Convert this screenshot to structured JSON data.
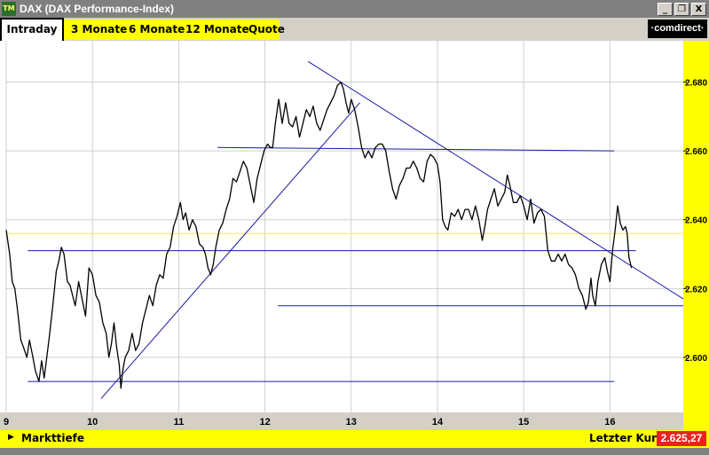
{
  "window": {
    "title": "DAX (DAX Performance-Index)",
    "app_icon_text": "TM",
    "buttons": {
      "minimize": "_",
      "restore": "❐",
      "close": "X"
    }
  },
  "tabs": [
    {
      "label": "Intraday",
      "active": true
    },
    {
      "label": "3 Monate",
      "active": false
    },
    {
      "label": "6 Monate",
      "active": false
    },
    {
      "label": "12 Monate",
      "active": false
    },
    {
      "label": "Quote",
      "active": false
    }
  ],
  "logo": "·comdirect·",
  "bottom": {
    "left_label": "Markttiefe",
    "right_label": "Letzter Kurs",
    "last_price": "2.625,27"
  },
  "colors": {
    "price_line": "#000000",
    "trend_lines": "#1a1aa0",
    "reference_line": "#ffff00",
    "axis_background": "#ffff00",
    "last_price_background": "#e8231f"
  },
  "chart_data": {
    "type": "line",
    "title": "",
    "xlabel": "",
    "ylabel": "",
    "x_ticks": [
      "9",
      "10",
      "11",
      "12",
      "13",
      "14",
      "15",
      "16"
    ],
    "y_ticks": [
      "2.680",
      "2.660",
      "2.640",
      "2.620",
      "2.600"
    ],
    "xlim": [
      9,
      16.85
    ],
    "ylim": [
      2584,
      2692
    ],
    "grid": true,
    "reference_level": 2636,
    "series": [
      {
        "values": [
          [
            9.0,
            2637
          ],
          [
            9.04,
            2630
          ],
          [
            9.07,
            2622
          ],
          [
            9.1,
            2620
          ],
          [
            9.13,
            2614
          ],
          [
            9.17,
            2605
          ],
          [
            9.2,
            2603
          ],
          [
            9.24,
            2600
          ],
          [
            9.27,
            2605
          ],
          [
            9.31,
            2600
          ],
          [
            9.34,
            2596
          ],
          [
            9.38,
            2593
          ],
          [
            9.41,
            2599
          ],
          [
            9.44,
            2594
          ],
          [
            9.47,
            2600
          ],
          [
            9.5,
            2606
          ],
          [
            9.54,
            2615
          ],
          [
            9.58,
            2625
          ],
          [
            9.61,
            2628
          ],
          [
            9.64,
            2632
          ],
          [
            9.67,
            2630
          ],
          [
            9.71,
            2622
          ],
          [
            9.74,
            2621
          ],
          [
            9.77,
            2618
          ],
          [
            9.8,
            2615
          ],
          [
            9.84,
            2622
          ],
          [
            9.88,
            2617
          ],
          [
            9.92,
            2612
          ],
          [
            9.96,
            2626
          ],
          [
            10.0,
            2624
          ],
          [
            10.04,
            2618
          ],
          [
            10.08,
            2616
          ],
          [
            10.12,
            2610
          ],
          [
            10.16,
            2607
          ],
          [
            10.19,
            2600
          ],
          [
            10.22,
            2604
          ],
          [
            10.25,
            2610
          ],
          [
            10.28,
            2603
          ],
          [
            10.31,
            2598
          ],
          [
            10.33,
            2591
          ],
          [
            10.35,
            2596
          ],
          [
            10.38,
            2600
          ],
          [
            10.42,
            2602
          ],
          [
            10.46,
            2607
          ],
          [
            10.5,
            2602
          ],
          [
            10.54,
            2604
          ],
          [
            10.58,
            2610
          ],
          [
            10.62,
            2614
          ],
          [
            10.66,
            2618
          ],
          [
            10.7,
            2615
          ],
          [
            10.74,
            2621
          ],
          [
            10.78,
            2624
          ],
          [
            10.82,
            2623
          ],
          [
            10.86,
            2630
          ],
          [
            10.9,
            2632
          ],
          [
            10.94,
            2638
          ],
          [
            10.98,
            2641
          ],
          [
            11.02,
            2645
          ],
          [
            11.05,
            2640
          ],
          [
            11.08,
            2642
          ],
          [
            11.12,
            2637
          ],
          [
            11.16,
            2640
          ],
          [
            11.2,
            2638
          ],
          [
            11.24,
            2633
          ],
          [
            11.28,
            2632
          ],
          [
            11.31,
            2630
          ],
          [
            11.34,
            2626
          ],
          [
            11.37,
            2624
          ],
          [
            11.4,
            2627
          ],
          [
            11.43,
            2632
          ],
          [
            11.47,
            2637
          ],
          [
            11.51,
            2639
          ],
          [
            11.55,
            2643
          ],
          [
            11.59,
            2646
          ],
          [
            11.63,
            2652
          ],
          [
            11.67,
            2651
          ],
          [
            11.71,
            2654
          ],
          [
            11.75,
            2657
          ],
          [
            11.79,
            2655
          ],
          [
            11.83,
            2650
          ],
          [
            11.87,
            2645
          ],
          [
            11.91,
            2652
          ],
          [
            11.95,
            2656
          ],
          [
            11.99,
            2660
          ],
          [
            12.03,
            2662
          ],
          [
            12.06,
            2661
          ],
          [
            12.09,
            2661
          ],
          [
            12.12,
            2668
          ],
          [
            12.16,
            2675
          ],
          [
            12.2,
            2668
          ],
          [
            12.24,
            2674
          ],
          [
            12.28,
            2668
          ],
          [
            12.32,
            2667
          ],
          [
            12.36,
            2670
          ],
          [
            12.4,
            2664
          ],
          [
            12.44,
            2668
          ],
          [
            12.48,
            2672
          ],
          [
            12.52,
            2670
          ],
          [
            12.56,
            2673
          ],
          [
            12.6,
            2668
          ],
          [
            12.64,
            2666
          ],
          [
            12.68,
            2669
          ],
          [
            12.72,
            2672
          ],
          [
            12.76,
            2674
          ],
          [
            12.8,
            2676
          ],
          [
            12.84,
            2679
          ],
          [
            12.88,
            2680
          ],
          [
            12.91,
            2678
          ],
          [
            12.94,
            2674
          ],
          [
            12.97,
            2671
          ],
          [
            13.0,
            2675
          ],
          [
            13.04,
            2672
          ],
          [
            13.08,
            2667
          ],
          [
            13.12,
            2661
          ],
          [
            13.16,
            2658
          ],
          [
            13.2,
            2660
          ],
          [
            13.24,
            2658
          ],
          [
            13.28,
            2661
          ],
          [
            13.32,
            2662
          ],
          [
            13.36,
            2662
          ],
          [
            13.4,
            2660
          ],
          [
            13.44,
            2654
          ],
          [
            13.48,
            2649
          ],
          [
            13.52,
            2646
          ],
          [
            13.56,
            2650
          ],
          [
            13.6,
            2652
          ],
          [
            13.64,
            2655
          ],
          [
            13.68,
            2655
          ],
          [
            13.72,
            2657
          ],
          [
            13.76,
            2655
          ],
          [
            13.8,
            2652
          ],
          [
            13.84,
            2651
          ],
          [
            13.88,
            2657
          ],
          [
            13.92,
            2659
          ],
          [
            13.96,
            2658
          ],
          [
            14.0,
            2656
          ],
          [
            14.03,
            2651
          ],
          [
            14.06,
            2640
          ],
          [
            14.09,
            2638
          ],
          [
            14.12,
            2637
          ],
          [
            14.16,
            2642
          ],
          [
            14.2,
            2641
          ],
          [
            14.24,
            2643
          ],
          [
            14.28,
            2640
          ],
          [
            14.32,
            2643
          ],
          [
            14.36,
            2643
          ],
          [
            14.4,
            2640
          ],
          [
            14.44,
            2644
          ],
          [
            14.48,
            2640
          ],
          [
            14.52,
            2634
          ],
          [
            14.55,
            2638
          ],
          [
            14.58,
            2643
          ],
          [
            14.62,
            2646
          ],
          [
            14.66,
            2649
          ],
          [
            14.7,
            2644
          ],
          [
            14.74,
            2646
          ],
          [
            14.78,
            2648
          ],
          [
            14.81,
            2653
          ],
          [
            14.84,
            2650
          ],
          [
            14.88,
            2645
          ],
          [
            14.92,
            2645
          ],
          [
            14.96,
            2647
          ],
          [
            15.0,
            2644
          ],
          [
            15.04,
            2640
          ],
          [
            15.08,
            2646
          ],
          [
            15.12,
            2639
          ],
          [
            15.16,
            2642
          ],
          [
            15.2,
            2643
          ],
          [
            15.24,
            2641
          ],
          [
            15.28,
            2631
          ],
          [
            15.32,
            2628
          ],
          [
            15.36,
            2628
          ],
          [
            15.4,
            2630
          ],
          [
            15.44,
            2628
          ],
          [
            15.48,
            2630
          ],
          [
            15.52,
            2627
          ],
          [
            15.56,
            2626
          ],
          [
            15.6,
            2624
          ],
          [
            15.64,
            2620
          ],
          [
            15.68,
            2618
          ],
          [
            15.72,
            2614
          ],
          [
            15.75,
            2616
          ],
          [
            15.78,
            2623
          ],
          [
            15.8,
            2618
          ],
          [
            15.83,
            2615
          ],
          [
            15.86,
            2622
          ],
          [
            15.9,
            2627
          ],
          [
            15.94,
            2629
          ],
          [
            15.97,
            2625
          ],
          [
            16.0,
            2622
          ],
          [
            16.03,
            2631
          ],
          [
            16.06,
            2637
          ],
          [
            16.09,
            2644
          ],
          [
            16.12,
            2639
          ],
          [
            16.15,
            2637
          ],
          [
            16.18,
            2638
          ],
          [
            16.2,
            2636
          ],
          [
            16.22,
            2629
          ],
          [
            16.25,
            2626
          ]
        ]
      }
    ],
    "trend_lines": [
      {
        "from": [
          10.1,
          2588
        ],
        "to": [
          13.1,
          2674
        ]
      },
      {
        "from": [
          12.5,
          2686
        ],
        "to": [
          16.85,
          2617
        ]
      },
      {
        "from": [
          9.25,
          2593
        ],
        "to": [
          16.05,
          2593
        ]
      },
      {
        "from": [
          12.15,
          2615
        ],
        "to": [
          16.85,
          2615
        ]
      },
      {
        "from": [
          9.25,
          2631
        ],
        "to": [
          16.3,
          2631
        ]
      },
      {
        "from": [
          11.45,
          2661
        ],
        "to": [
          16.05,
          2660
        ]
      }
    ]
  }
}
